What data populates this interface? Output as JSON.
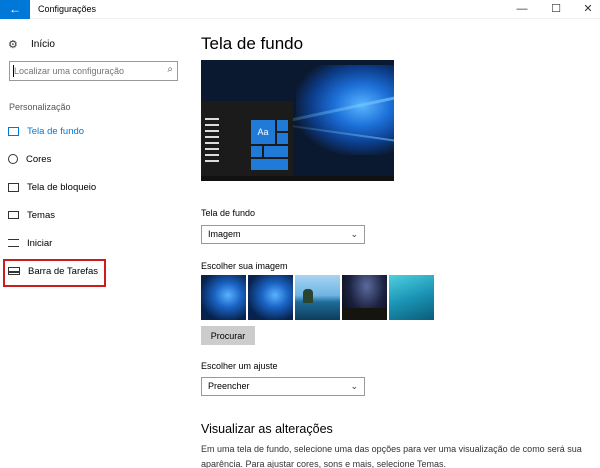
{
  "window": {
    "title": "Configurações",
    "back_icon": "arrow-left-icon",
    "minimize_glyph": "—",
    "maximize_glyph": "☐",
    "close_glyph": "✕"
  },
  "sidebar": {
    "home_label": "Início",
    "search_placeholder": "Localizar uma configuração",
    "section_label": "Personalização",
    "items": [
      {
        "label": "Tela de fundo",
        "icon": "picture-icon",
        "active": true
      },
      {
        "label": "Cores",
        "icon": "palette-icon",
        "active": false
      },
      {
        "label": "Tela de bloqueio",
        "icon": "lock-screen-icon",
        "active": false
      },
      {
        "label": "Temas",
        "icon": "themes-icon",
        "active": false
      },
      {
        "label": "Iniciar",
        "icon": "start-icon",
        "active": false
      },
      {
        "label": "Barra de Tarefas",
        "icon": "taskbar-icon",
        "active": false
      }
    ]
  },
  "main": {
    "title": "Tela de fundo",
    "preview_tile_label": "Aa",
    "background_label": "Tela de fundo",
    "background_value": "Imagem",
    "choose_image_label": "Escolher sua imagem",
    "browse_button": "Procurar",
    "fit_label": "Escolher um ajuste",
    "fit_value": "Preencher",
    "preview_section_title": "Visualizar as alterações",
    "preview_description": "Em uma tela de fundo, selecione uma das opções para ver uma visualização de como será sua aparência. Para ajustar cores, sons e mais, selecione Temas."
  },
  "colors": {
    "accent": "#0078d7",
    "highlight_box": "#cc1d1d"
  }
}
